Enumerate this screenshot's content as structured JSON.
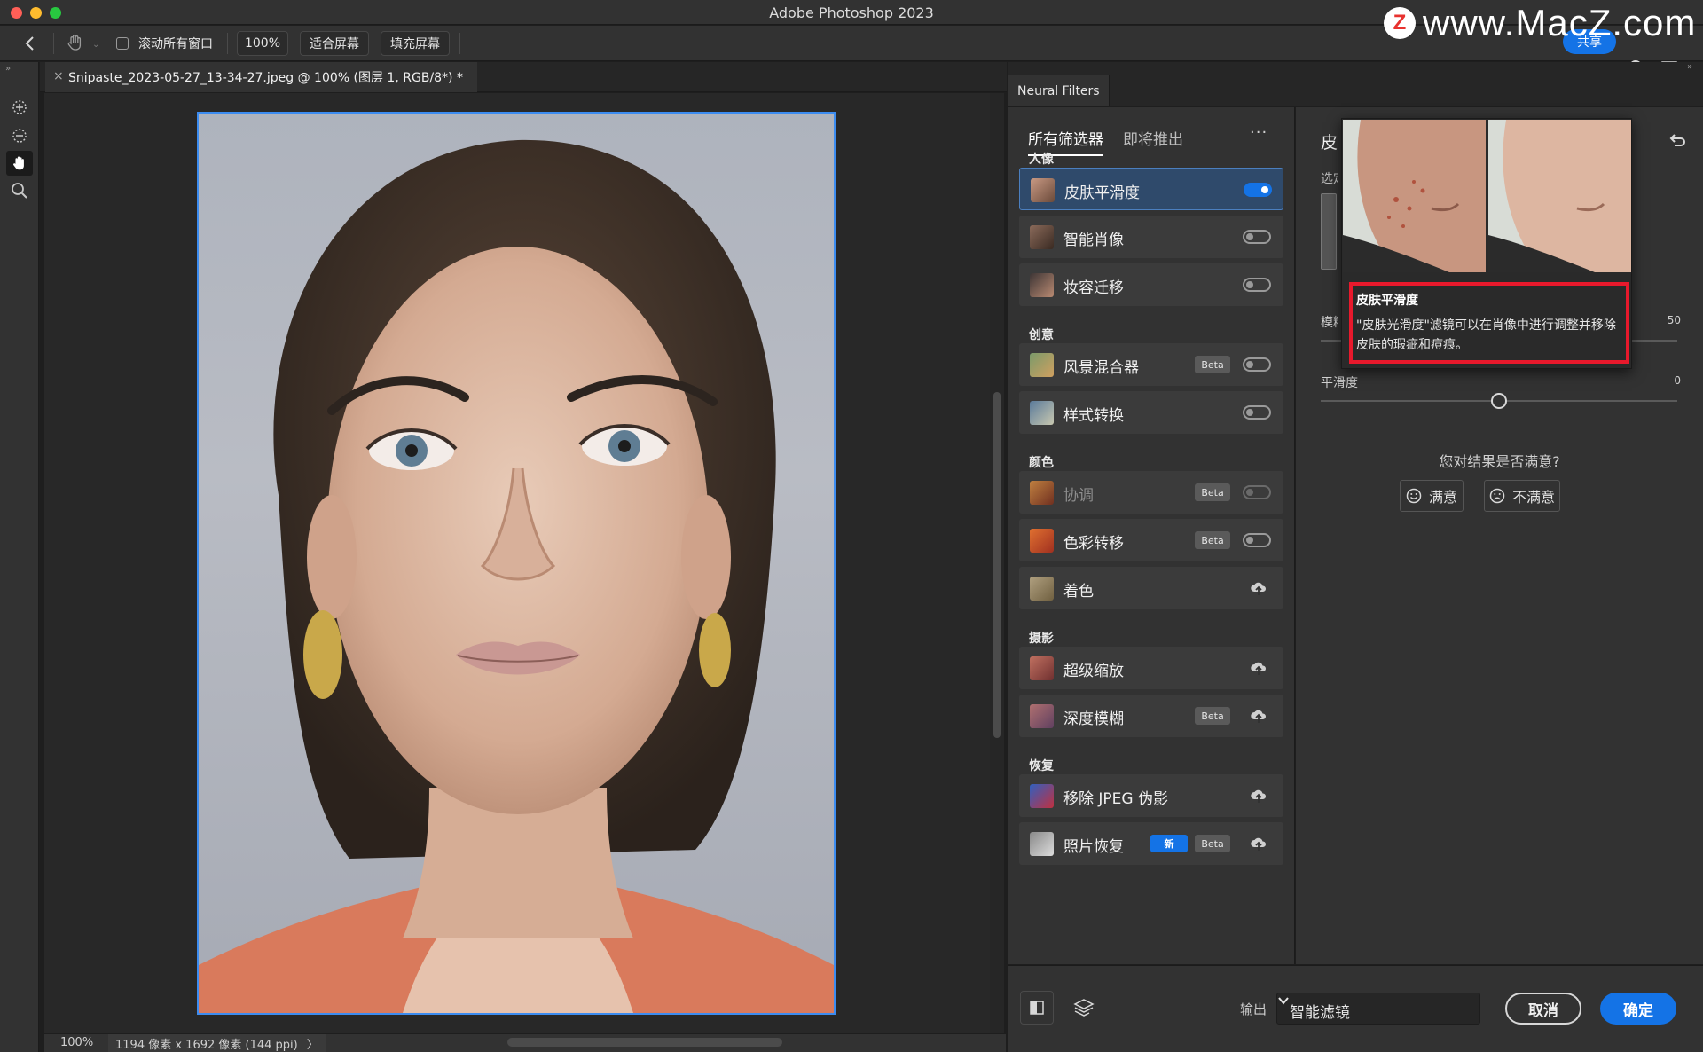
{
  "window": {
    "title": "Adobe Photoshop 2023",
    "watermark_logo": "Z",
    "watermark": "www.MacZ.com"
  },
  "options_bar": {
    "scroll_all_label": "滚动所有窗口",
    "zoom_100": "100%",
    "fit_screen": "适合屏幕",
    "fill_screen": "填充屏幕",
    "share": "共享"
  },
  "document": {
    "tab_label": "Snipaste_2023-05-27_13-34-27.jpeg @ 100% (图层 1, RGB/8*) *",
    "close": "×"
  },
  "status": {
    "zoom": "100%",
    "info": "1194 像素 x 1692 像素 (144 ppi)",
    "arrow": "〉"
  },
  "panel": {
    "tab": "Neural Filters",
    "tabs": [
      "所有筛选器",
      "即将推出"
    ],
    "more": "···",
    "badges": {
      "beta": "Beta",
      "new": "新"
    },
    "categories": [
      {
        "name": "人像",
        "filters": [
          {
            "name": "皮肤平滑度",
            "state": "on",
            "selected": true
          },
          {
            "name": "智能肖像",
            "state": "off"
          },
          {
            "name": "妆容迁移",
            "state": "off"
          }
        ]
      },
      {
        "name": "创意",
        "filters": [
          {
            "name": "风景混合器",
            "state": "off",
            "beta": true
          },
          {
            "name": "样式转换",
            "state": "off"
          }
        ]
      },
      {
        "name": "颜色",
        "filters": [
          {
            "name": "协调",
            "state": "off",
            "beta": true,
            "disabled": true
          },
          {
            "name": "色彩转移",
            "state": "off",
            "beta": true
          },
          {
            "name": "着色",
            "state": "cloud"
          }
        ]
      },
      {
        "name": "摄影",
        "filters": [
          {
            "name": "超级缩放",
            "state": "cloud"
          },
          {
            "name": "深度模糊",
            "state": "cloud",
            "beta": true
          }
        ]
      },
      {
        "name": "恢复",
        "filters": [
          {
            "name": "移除 JPEG 伪影",
            "state": "cloud"
          },
          {
            "name": "照片恢复",
            "state": "cloud",
            "beta": true,
            "new": true
          }
        ]
      }
    ]
  },
  "detail": {
    "title": "皮肤平滑度",
    "select_label": "选定",
    "blur_label": "模糊",
    "blur_value": "50",
    "blur_fraction": 0.0,
    "smooth_label": "平滑度",
    "smooth_value": "0",
    "smooth_fraction": 0.5,
    "satisfied_question": "您对结果是否满意?",
    "satisfied": "满意",
    "unsatisfied": "不满意"
  },
  "tooltip": {
    "title": "皮肤平滑度",
    "description": "\"皮肤光滑度\"滤镜可以在肖像中进行调整并移除皮肤的瑕疵和痘痕。"
  },
  "bottom": {
    "output_label": "输出",
    "output_value": "智能滤镜",
    "cancel": "取消",
    "ok": "确定"
  },
  "colors": {
    "accent": "#1473e6",
    "highlight_box": "#e8192c",
    "selection_border": "#3c8cf0"
  }
}
